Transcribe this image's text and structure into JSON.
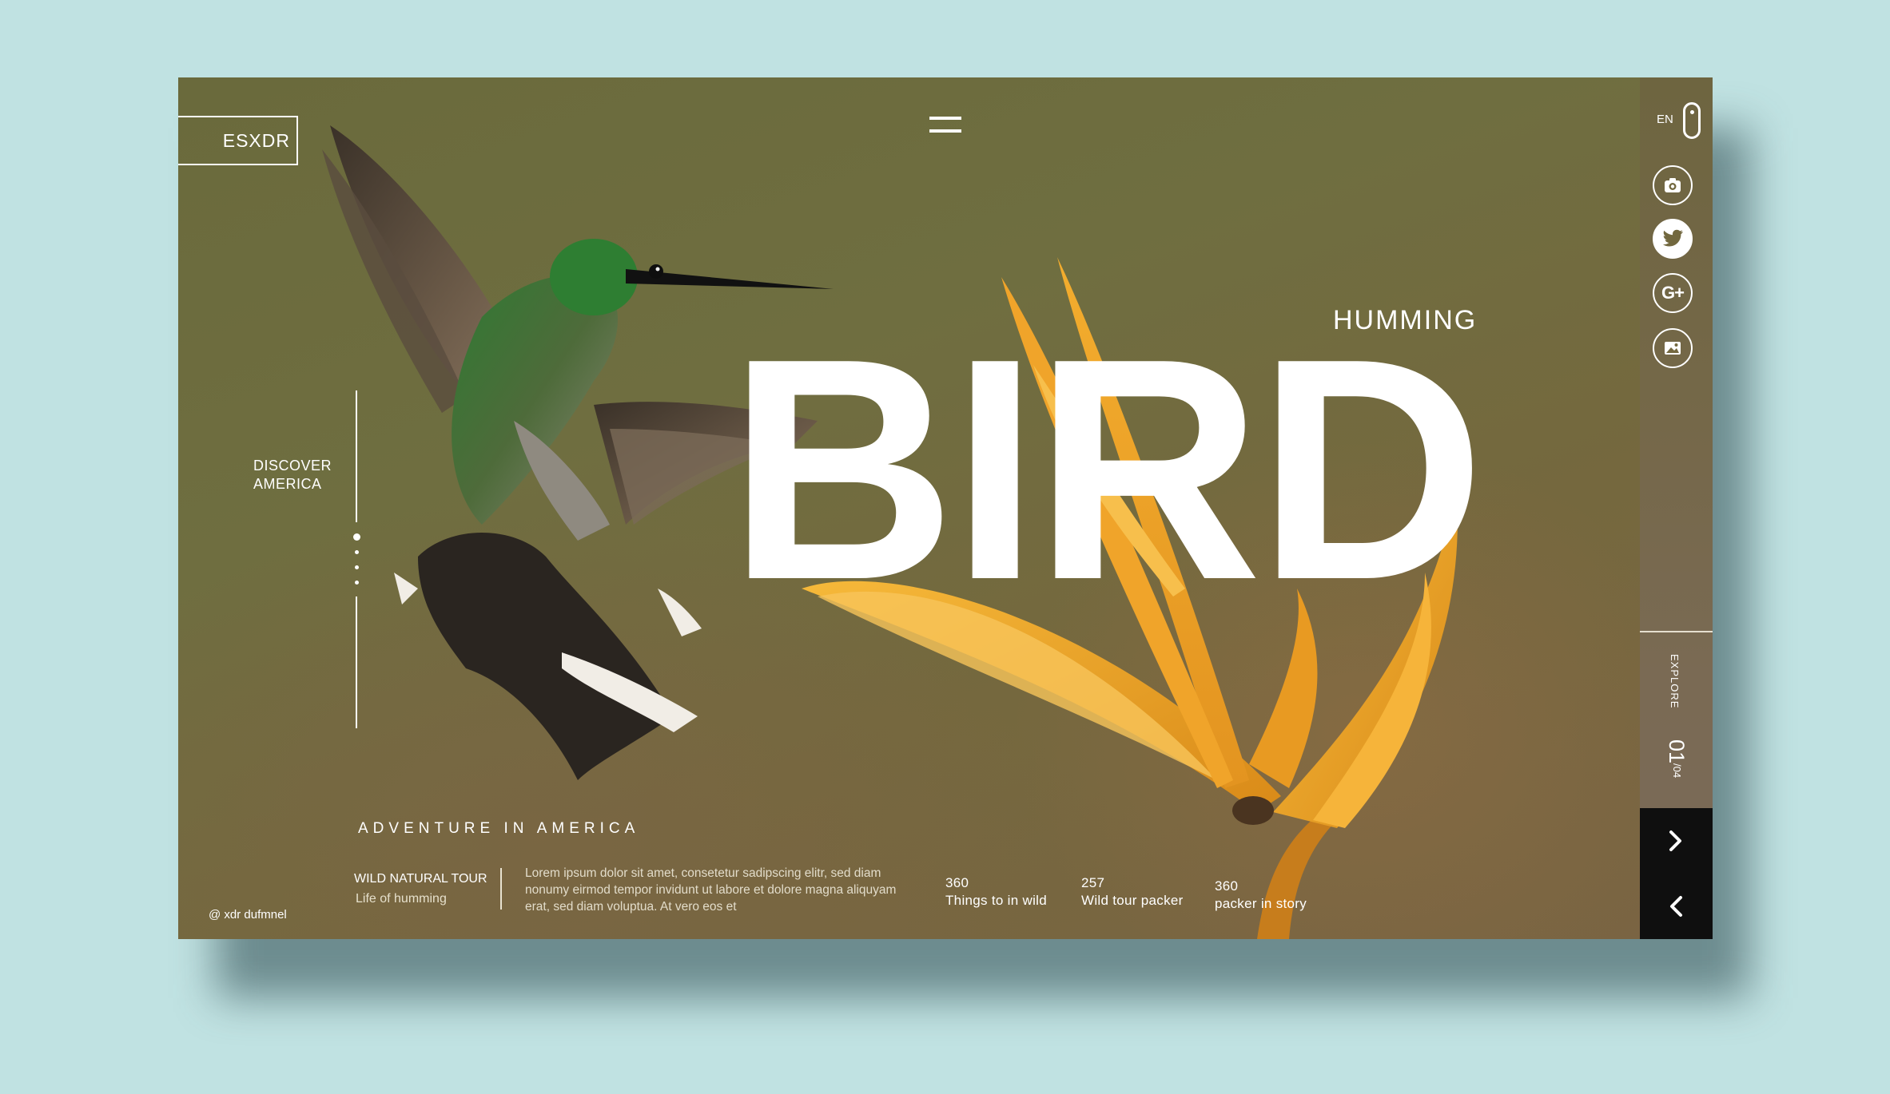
{
  "brand": "ESXDR",
  "side_nav": {
    "discover_line1": "DISCOVER",
    "discover_line2": "AMERICA"
  },
  "hero": {
    "kicker": "HUMMING",
    "headline": "BIRD"
  },
  "tagline": "ADVENTURE IN AMERICA",
  "tour": {
    "title": "WILD NATURAL TOUR",
    "subtitle": "Life of humming",
    "description": "Lorem ipsum dolor sit amet, consetetur sadipscing elitr, sed diam nonumy eirmod tempor invidunt ut labore et dolore magna aliquyam erat, sed diam voluptua. At vero eos et"
  },
  "stats": [
    {
      "value": "360",
      "label": "Things to in wild"
    },
    {
      "value": "257",
      "label": "Wild tour packer"
    },
    {
      "value": "360",
      "label": "packer in story"
    }
  ],
  "copyright": "@ xdr dufmnel",
  "sidebar": {
    "language": "EN",
    "social_icons": [
      "camera-icon",
      "twitter-icon",
      "google-plus-icon",
      "image-icon"
    ],
    "google_plus_label": "G+",
    "explore_label": "EXPLORE",
    "page_current": "01",
    "page_total": "/04"
  },
  "colors": {
    "background": "#c0e2e2",
    "photo_olive": "#6f6e40",
    "flower_orange": "#f0a42a",
    "nav_dark": "#0f0f0f",
    "text": "#ffffff"
  }
}
